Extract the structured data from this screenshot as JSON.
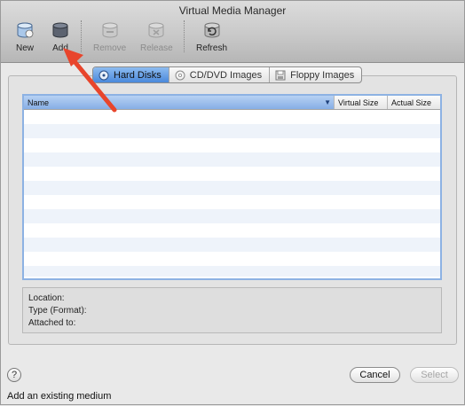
{
  "window": {
    "title": "Virtual Media Manager"
  },
  "toolbar": {
    "buttons": [
      {
        "label": "New",
        "icon": "new-disk-icon",
        "enabled": true
      },
      {
        "label": "Add",
        "icon": "add-disk-icon",
        "enabled": true
      },
      {
        "label": "Remove",
        "icon": "remove-disk-icon",
        "enabled": false
      },
      {
        "label": "Release",
        "icon": "release-disk-icon",
        "enabled": false
      },
      {
        "label": "Refresh",
        "icon": "refresh-icon",
        "enabled": true
      }
    ]
  },
  "tabs": [
    {
      "label": "Hard Disks",
      "icon": "hard-disk-icon",
      "active": true
    },
    {
      "label": "CD/DVD Images",
      "icon": "cd-icon",
      "active": false
    },
    {
      "label": "Floppy Images",
      "icon": "floppy-icon",
      "active": false
    }
  ],
  "table": {
    "columns": [
      "Name",
      "Virtual Size",
      "Actual Size"
    ],
    "sort_indicator": "▼",
    "rows": []
  },
  "info": {
    "location_label": "Location:",
    "type_label": "Type (Format):",
    "attached_label": "Attached to:"
  },
  "footer": {
    "help_symbol": "?",
    "cancel_label": "Cancel",
    "select_label": "Select",
    "status_text": "Add an existing medium"
  },
  "colors": {
    "annotation_arrow": "#e8452c",
    "selection_blue": "#4a89db"
  }
}
